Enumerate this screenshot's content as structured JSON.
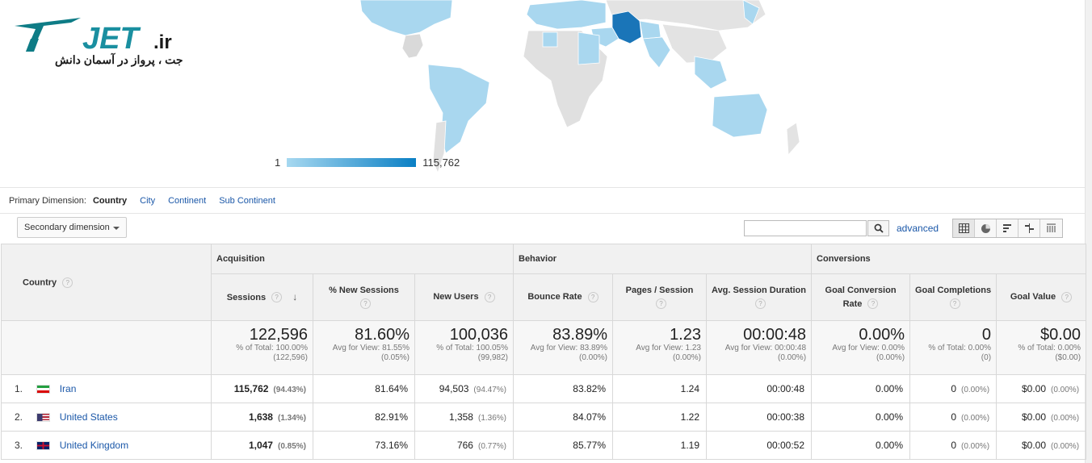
{
  "logo": {
    "brand": "JET.ir",
    "tagline": "جت ، پرواز در آسمان دانش"
  },
  "map": {
    "legend_min": "1",
    "legend_max": "115,762",
    "colors": {
      "low": "#a6d8f0",
      "high": "#0a7fc4",
      "none": "#e6e6e6",
      "highlight": "#1a75b8"
    }
  },
  "dimension": {
    "label": "Primary Dimension:",
    "active": "Country",
    "options": [
      "City",
      "Continent",
      "Sub Continent"
    ]
  },
  "toolbar": {
    "secondary_dimension": "Secondary dimension",
    "advanced": "advanced"
  },
  "table": {
    "country_header": "Country",
    "groups": {
      "acquisition": "Acquisition",
      "behavior": "Behavior",
      "conversions": "Conversions"
    },
    "columns": [
      {
        "label": "Sessions"
      },
      {
        "label": "% New Sessions"
      },
      {
        "label": "New Users"
      },
      {
        "label": "Bounce Rate"
      },
      {
        "label": "Pages / Session"
      },
      {
        "label": "Avg. Session Duration"
      },
      {
        "label": "Goal Conversion Rate"
      },
      {
        "label": "Goal Completions"
      },
      {
        "label": "Goal Value"
      }
    ],
    "totals": [
      {
        "value": "122,596",
        "sub1": "% of Total: 100.00%",
        "sub2": "(122,596)"
      },
      {
        "value": "81.60%",
        "sub1": "Avg for View: 81.55%",
        "sub2": "(0.05%)"
      },
      {
        "value": "100,036",
        "sub1": "% of Total: 100.05%",
        "sub2": "(99,982)"
      },
      {
        "value": "83.89%",
        "sub1": "Avg for View: 83.89%",
        "sub2": "(0.00%)"
      },
      {
        "value": "1.23",
        "sub1": "Avg for View: 1.23",
        "sub2": "(0.00%)"
      },
      {
        "value": "00:00:48",
        "sub1": "Avg for View: 00:00:48",
        "sub2": "(0.00%)"
      },
      {
        "value": "0.00%",
        "sub1": "Avg for View: 0.00%",
        "sub2": "(0.00%)"
      },
      {
        "value": "0",
        "sub1": "% of Total: 0.00%",
        "sub2": "(0)"
      },
      {
        "value": "$0.00",
        "sub1": "% of Total: 0.00%",
        "sub2": "($0.00)"
      }
    ],
    "rows": [
      {
        "num": "1.",
        "country": "Iran",
        "flag": "iran-flag-icon",
        "sessions": "115,762",
        "sessions_pct": "(94.43%)",
        "new_sessions": "81.64%",
        "new_users": "94,503",
        "new_users_pct": "(94.47%)",
        "bounce": "83.82%",
        "pages": "1.24",
        "duration": "00:00:48",
        "conv_rate": "0.00%",
        "completions": "0",
        "completions_pct": "(0.00%)",
        "value": "$0.00",
        "value_pct": "(0.00%)"
      },
      {
        "num": "2.",
        "country": "United States",
        "flag": "us-flag-icon",
        "sessions": "1,638",
        "sessions_pct": "(1.34%)",
        "new_sessions": "82.91%",
        "new_users": "1,358",
        "new_users_pct": "(1.36%)",
        "bounce": "84.07%",
        "pages": "1.22",
        "duration": "00:00:38",
        "conv_rate": "0.00%",
        "completions": "0",
        "completions_pct": "(0.00%)",
        "value": "$0.00",
        "value_pct": "(0.00%)"
      },
      {
        "num": "3.",
        "country": "United Kingdom",
        "flag": "uk-flag-icon",
        "sessions": "1,047",
        "sessions_pct": "(0.85%)",
        "new_sessions": "73.16%",
        "new_users": "766",
        "new_users_pct": "(0.77%)",
        "bounce": "85.77%",
        "pages": "1.19",
        "duration": "00:00:52",
        "conv_rate": "0.00%",
        "completions": "0",
        "completions_pct": "(0.00%)",
        "value": "$0.00",
        "value_pct": "(0.00%)"
      }
    ]
  }
}
